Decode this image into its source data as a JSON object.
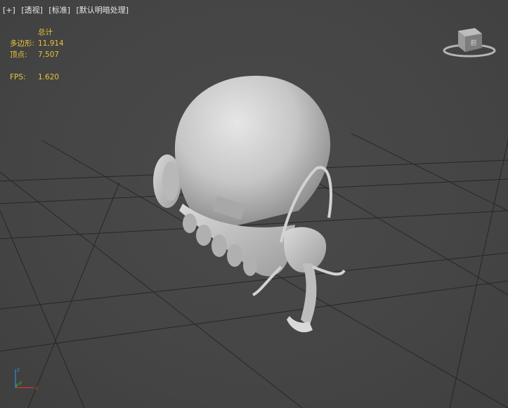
{
  "viewport": {
    "menu_plus": "[+]",
    "menu_view": "[透视]",
    "menu_shading": "[标准]",
    "menu_lighting": "[默认明暗处理]"
  },
  "stats": {
    "header": "总计",
    "polygons_label": "多边形:",
    "polygons_value": "11,914",
    "vertices_label": "顶点:",
    "vertices_value": "7,507",
    "fps_label": "FPS:",
    "fps_value": "1.620"
  },
  "viewcube": {
    "face_label": "前"
  },
  "axis": {
    "x": "x",
    "y": "y",
    "z": "z"
  },
  "colors": {
    "background": "#464646",
    "stats_text": "#e8c43a",
    "grid_line": "#1e1e1e",
    "model": "#cfcfcf"
  }
}
